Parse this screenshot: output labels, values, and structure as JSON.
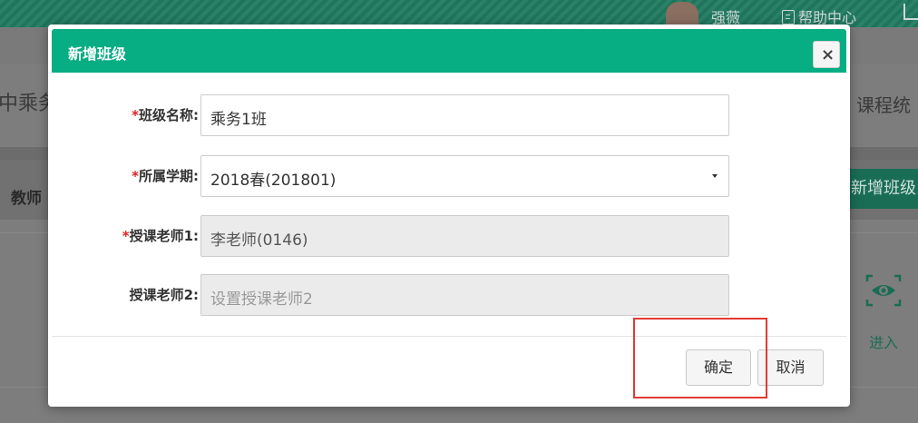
{
  "topbar": {
    "user_name": "强薇",
    "help_label": "帮助中心"
  },
  "background": {
    "page_title": "中乘务",
    "course_tab": "课程统",
    "teacher_col": "教师",
    "add_class_button": "新增班级",
    "enter_label": "进入"
  },
  "modal": {
    "title": "新增班级",
    "close_symbol": "×",
    "fields": [
      {
        "label": "班级名称:",
        "required": true,
        "value": "乘务1班",
        "placeholder": ""
      },
      {
        "label": "所属学期:",
        "required": true,
        "value": "2018春(201801)",
        "placeholder": ""
      },
      {
        "label": "授课老师1:",
        "required": true,
        "value": "李老师(0146)",
        "placeholder": ""
      },
      {
        "label": "授课老师2:",
        "required": false,
        "value": "",
        "placeholder": "设置授课老师2"
      }
    ],
    "required_mark": "*",
    "ok_button": "确定",
    "cancel_button": "取消"
  },
  "colors": {
    "header_green": "#07ad83",
    "required_red": "#e02020",
    "highlight_red": "#e23a32"
  }
}
